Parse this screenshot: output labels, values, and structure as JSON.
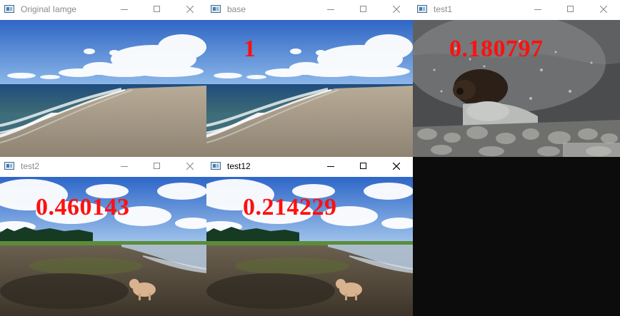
{
  "windows": [
    {
      "id": "original",
      "title": "Original Iamge",
      "image": "beach-scene",
      "score": ""
    },
    {
      "id": "base",
      "title": "base",
      "image": "beach-scene",
      "score": "1"
    },
    {
      "id": "test1",
      "title": "test1",
      "image": "bear-splash-scene",
      "score": "0.180797"
    },
    {
      "id": "test2",
      "title": "test2",
      "image": "dog-beach-scene",
      "score": "0.460143"
    },
    {
      "id": "test12",
      "title": "test12",
      "image": "dog-beach-scene",
      "score": "0.214229"
    }
  ],
  "colors": {
    "score_text": "#ff1010",
    "background": "#0c0c0c"
  }
}
